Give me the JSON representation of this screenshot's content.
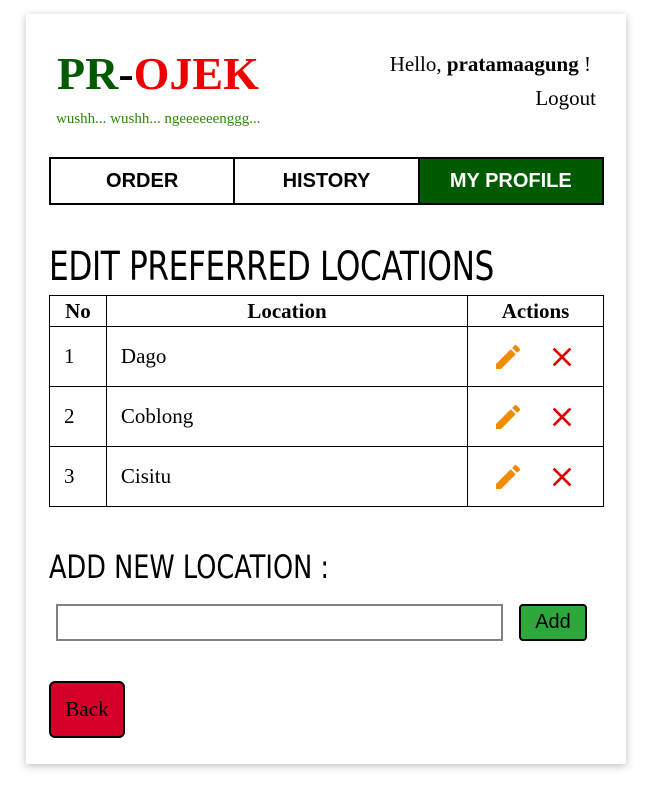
{
  "header": {
    "logo_part1": "PR",
    "logo_dash": "-",
    "logo_part2": "OJEK",
    "tagline": "wushh... wushh... ngeeeeeenggg...",
    "greeting_prefix": "Hello, ",
    "username": "pratamaagung",
    "greeting_suffix": " !",
    "logout_label": "Logout"
  },
  "nav": {
    "tabs": [
      {
        "label": "ORDER",
        "active": false
      },
      {
        "label": "HISTORY",
        "active": false
      },
      {
        "label": "MY PROFILE",
        "active": true
      }
    ]
  },
  "main": {
    "title": "EDIT PREFERRED LOCATIONS",
    "table": {
      "headers": [
        "No",
        "Location",
        "Actions"
      ],
      "rows": [
        {
          "no": "1",
          "location": "Dago"
        },
        {
          "no": "2",
          "location": "Coblong"
        },
        {
          "no": "3",
          "location": "Cisitu"
        }
      ]
    },
    "add_title": "ADD NEW LOCATION :",
    "add_input_value": "",
    "add_button_label": "Add",
    "back_button_label": "Back"
  },
  "icons": {
    "edit": "pencil-icon",
    "delete": "close-icon"
  },
  "colors": {
    "brand_green": "#005a00",
    "brand_red": "#ee0000",
    "tagline_green": "#2e8b00",
    "edit_icon": "#f08a00",
    "delete_icon": "#e00000",
    "add_button": "#2ea83a",
    "back_button": "#d4002a"
  }
}
